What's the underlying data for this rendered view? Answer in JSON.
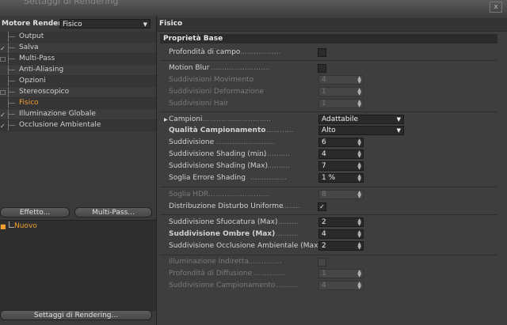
{
  "window": {
    "title": "Settaggi di Rendering",
    "close": "x"
  },
  "left": {
    "renderer_label": "Motore Render",
    "renderer_value": "Fisico",
    "items": [
      {
        "label": "Output",
        "check": ""
      },
      {
        "label": "Salva",
        "check": "✓"
      },
      {
        "label": "Multi-Pass",
        "check": "☐"
      },
      {
        "label": "Anti-Aliasing",
        "check": ""
      },
      {
        "label": "Opzioni",
        "check": ""
      },
      {
        "label": "Stereoscopico",
        "check": "☐"
      },
      {
        "label": "Fisico",
        "check": ""
      },
      {
        "label": "Illuminazione Globale",
        "check": "✓"
      },
      {
        "label": "Occlusione Ambientale",
        "check": "✓"
      }
    ],
    "effect_button": "Effetto...",
    "multipass_button": "Multi-Pass...",
    "preset_name": "Nuovo",
    "render_settings_button": "Settaggi di Rendering..."
  },
  "right": {
    "tab_title": "Fisico",
    "section_title": "Proprietà Base",
    "depth_of_field": "Profondità di campo",
    "motion_blur": "Motion Blur",
    "move_subdiv": {
      "label": "Suddivisioni Movimento",
      "value": "4"
    },
    "deform_subdiv": {
      "label": "Suddivisioni Deformazione",
      "value": "1"
    },
    "hair_subdiv": {
      "label": "Suddivisioni Hair",
      "value": "1"
    },
    "sampler": {
      "label": "Campioni",
      "value": "Adattabile"
    },
    "sampling_quality": {
      "label": "Qualità Campionamento",
      "value": "Alto"
    },
    "subdivision": {
      "label": "Suddivisione",
      "value": "6"
    },
    "shading_min": {
      "label": "Suddivisione Shading (min)",
      "value": "4"
    },
    "shading_max": {
      "label": "Suddivisione Shading (Max)",
      "value": "7"
    },
    "shading_error": {
      "label": "Soglia Errore Shading",
      "value": "1 %"
    },
    "hdr_threshold": {
      "label": "Soglia HDR",
      "value": "8"
    },
    "uniform_noise": {
      "label": "Distribuzione Disturbo Uniforme",
      "check": "✓"
    },
    "blur_max": {
      "label": "Suddivisione Sfuocatura (Max)",
      "value": "2"
    },
    "shadow_max": {
      "label": "Suddivisione Ombre (Max)",
      "value": "4"
    },
    "ao_max": {
      "label": "Suddivisione Occlusione Ambientale (Max)",
      "value": "2"
    },
    "indirect_light": "Illuminazione Indiretta",
    "diffuse_depth": {
      "label": "Profondità di Diffusione",
      "value": "1"
    },
    "sampling_subdiv": {
      "label": "Suddivisione Campionamento",
      "value": "4"
    }
  },
  "colors": {
    "accent": "#f0a030",
    "panel": "#3b3b3b"
  }
}
